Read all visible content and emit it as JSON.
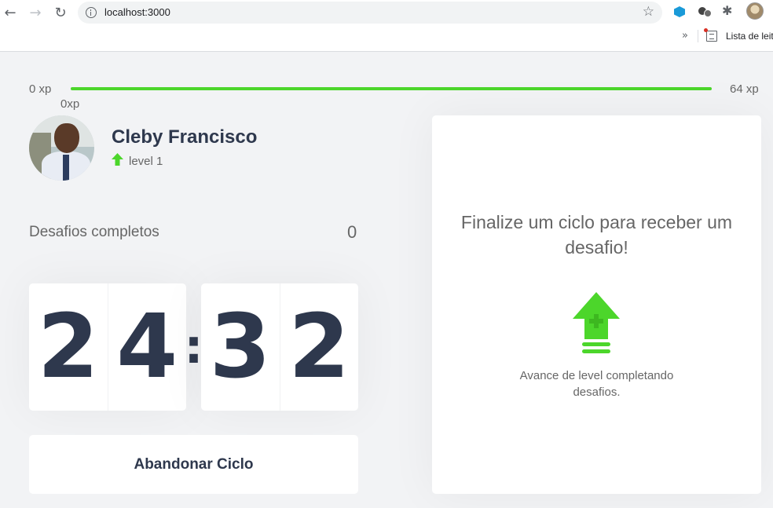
{
  "browser": {
    "url": "localhost:3000",
    "bookmarks_overflow": "»",
    "reading_list_label": "Lista de leit"
  },
  "xp": {
    "min_label": "0 xp",
    "max_label": "64 xp",
    "current_label": "0xp",
    "progress": 1.0
  },
  "profile": {
    "name": "Cleby Francisco",
    "level": "level 1"
  },
  "challenges": {
    "label": "Desafios completos",
    "count": "0"
  },
  "countdown": {
    "minutes": [
      "2",
      "4"
    ],
    "separator": ":",
    "seconds": [
      "3",
      "2"
    ]
  },
  "actions": {
    "abandon_label": "Abandonar Ciclo"
  },
  "challenge_box": {
    "title": "Finalize um ciclo para receber um desafio!",
    "description": "Avance de level completando desafios."
  },
  "colors": {
    "accent_green": "#4cd62b",
    "title_dark": "#2e384d",
    "text_gray": "#666666",
    "background": "#f2f3f5"
  }
}
